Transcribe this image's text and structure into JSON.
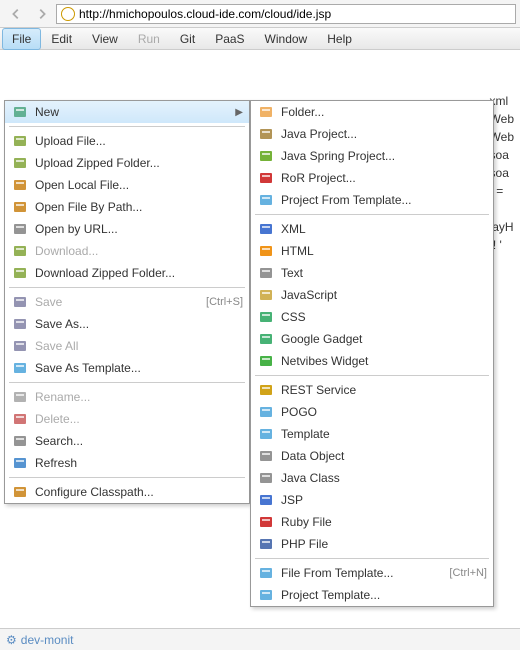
{
  "url": "http://hmichopoulos.cloud-ide.com/cloud/ide.jsp",
  "menubar": [
    "File",
    "Edit",
    "View",
    "Run",
    "Git",
    "PaaS",
    "Window",
    "Help"
  ],
  "menubar_active": 0,
  "menubar_disabled": [
    3
  ],
  "file_menu": [
    {
      "t": "item",
      "label": "New",
      "hl": true,
      "arrow": true,
      "ic": "new"
    },
    {
      "t": "sep"
    },
    {
      "t": "item",
      "label": "Upload File...",
      "ic": "up"
    },
    {
      "t": "item",
      "label": "Upload Zipped Folder...",
      "ic": "up"
    },
    {
      "t": "item",
      "label": "Open Local File...",
      "ic": "open"
    },
    {
      "t": "item",
      "label": "Open File By Path...",
      "ic": "open"
    },
    {
      "t": "item",
      "label": "Open by URL...",
      "ic": "url"
    },
    {
      "t": "item",
      "label": "Download...",
      "dis": true,
      "ic": "down"
    },
    {
      "t": "item",
      "label": "Download Zipped Folder...",
      "ic": "down"
    },
    {
      "t": "sep"
    },
    {
      "t": "item",
      "label": "Save",
      "sc": "[Ctrl+S]",
      "dis": true,
      "ic": "save"
    },
    {
      "t": "item",
      "label": "Save As...",
      "ic": "save"
    },
    {
      "t": "item",
      "label": "Save All",
      "dis": true,
      "ic": "save"
    },
    {
      "t": "item",
      "label": "Save As Template...",
      "ic": "tmpl"
    },
    {
      "t": "sep"
    },
    {
      "t": "item",
      "label": "Rename...",
      "dis": true,
      "ic": "ren"
    },
    {
      "t": "item",
      "label": "Delete...",
      "dis": true,
      "ic": "del"
    },
    {
      "t": "item",
      "label": "Search...",
      "ic": "search"
    },
    {
      "t": "item",
      "label": "Refresh",
      "ic": "refresh"
    },
    {
      "t": "sep"
    },
    {
      "t": "item",
      "label": "Configure Classpath...",
      "ic": "cls"
    }
  ],
  "new_menu": [
    {
      "t": "item",
      "label": "Folder...",
      "ic": "folder"
    },
    {
      "t": "item",
      "label": "Java Project...",
      "ic": "java"
    },
    {
      "t": "item",
      "label": "Java Spring Project...",
      "ic": "spring"
    },
    {
      "t": "item",
      "label": "RoR Project...",
      "ic": "ruby"
    },
    {
      "t": "item",
      "label": "Project From Template...",
      "ic": "tmpl"
    },
    {
      "t": "sep"
    },
    {
      "t": "item",
      "label": "XML",
      "ic": "xml"
    },
    {
      "t": "item",
      "label": "HTML",
      "ic": "html"
    },
    {
      "t": "item",
      "label": "Text",
      "ic": "txt"
    },
    {
      "t": "item",
      "label": "JavaScript",
      "ic": "js"
    },
    {
      "t": "item",
      "label": "CSS",
      "ic": "css"
    },
    {
      "t": "item",
      "label": "Google Gadget",
      "ic": "gg"
    },
    {
      "t": "item",
      "label": "Netvibes Widget",
      "ic": "nv"
    },
    {
      "t": "sep"
    },
    {
      "t": "item",
      "label": "REST Service",
      "ic": "rest"
    },
    {
      "t": "item",
      "label": "POGO",
      "ic": "pogo"
    },
    {
      "t": "item",
      "label": "Template",
      "ic": "tmpl"
    },
    {
      "t": "item",
      "label": "Data Object",
      "ic": "data"
    },
    {
      "t": "item",
      "label": "Java Class",
      "ic": "jclass"
    },
    {
      "t": "item",
      "label": "JSP",
      "ic": "jsp"
    },
    {
      "t": "item",
      "label": "Ruby File",
      "ic": "ruby"
    },
    {
      "t": "item",
      "label": "PHP File",
      "ic": "php"
    },
    {
      "t": "sep"
    },
    {
      "t": "item",
      "label": "File From Template...",
      "sc": "[Ctrl+N]",
      "ic": "tmpl"
    },
    {
      "t": "item",
      "label": "Project Template...",
      "ic": "tmpl"
    }
  ],
  "side_snips": [
    ".xml",
    ".Web",
    ".Web",
    ".soa",
    ".soa",
    "e =",
    "{",
    "sayH",
    "o! '"
  ],
  "status": "dev-monit",
  "icons": {
    "new": "#5a8",
    "up": "#8a4",
    "open": "#c82",
    "url": "#888",
    "down": "#8a4",
    "save": "#88a",
    "tmpl": "#5ad",
    "ren": "#aaa",
    "del": "#c66",
    "search": "#888",
    "refresh": "#48c",
    "cls": "#c82",
    "folder": "#ea5",
    "java": "#a84",
    "spring": "#6a2",
    "ruby": "#c22",
    "xml": "#36c",
    "html": "#e80",
    "txt": "#888",
    "js": "#ca4",
    "css": "#3a6",
    "gg": "#3a6",
    "nv": "#3a3",
    "rest": "#c90",
    "pogo": "#5ad",
    "data": "#888",
    "jclass": "#888",
    "jsp": "#36c",
    "php": "#46a"
  }
}
